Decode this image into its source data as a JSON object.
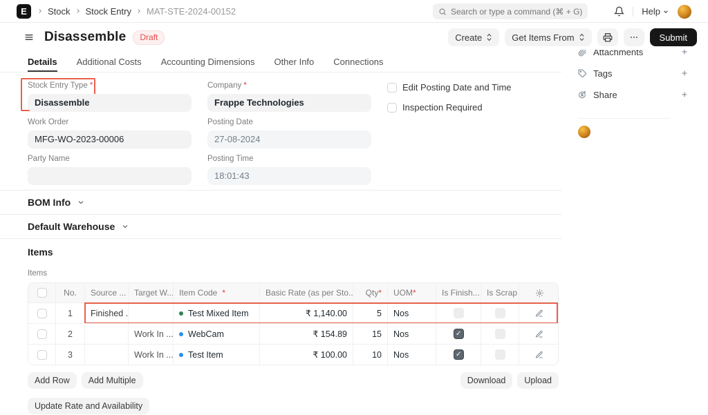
{
  "navbar": {
    "logo_letter": "E",
    "breadcrumb": [
      {
        "label": "Stock"
      },
      {
        "label": "Stock Entry"
      },
      {
        "label": "MAT-STE-2024-00152"
      }
    ],
    "search_placeholder": "Search or type a command (⌘ + G)",
    "help_label": "Help"
  },
  "header": {
    "title": "Disassemble",
    "status_badge": "Draft",
    "create_label": "Create",
    "get_items_from_label": "Get Items From",
    "submit_label": "Submit"
  },
  "tabs": [
    {
      "label": "Details",
      "active": true
    },
    {
      "label": "Additional Costs",
      "active": false
    },
    {
      "label": "Accounting Dimensions",
      "active": false
    },
    {
      "label": "Other Info",
      "active": false
    },
    {
      "label": "Connections",
      "active": false
    }
  ],
  "form": {
    "stock_entry_type": {
      "label": "Stock Entry Type",
      "value": "Disassemble"
    },
    "company": {
      "label": "Company",
      "value": "Frappe Technologies"
    },
    "edit_posting": {
      "label": "Edit Posting Date and Time",
      "checked": false
    },
    "inspection_required": {
      "label": "Inspection Required",
      "checked": false
    },
    "work_order": {
      "label": "Work Order",
      "value": "MFG-WO-2023-00006"
    },
    "posting_date": {
      "label": "Posting Date",
      "value": "27-08-2024"
    },
    "party_name": {
      "label": "Party Name",
      "value": ""
    },
    "posting_time": {
      "label": "Posting Time",
      "value": "18:01:43"
    }
  },
  "sections": {
    "bom_info": "BOM Info",
    "default_warehouse": "Default Warehouse",
    "items_heading": "Items",
    "items_sublabel": "Items"
  },
  "items_table": {
    "columns": [
      {
        "label": "No."
      },
      {
        "label": "Source ..."
      },
      {
        "label": "Target W..."
      },
      {
        "label": "Item Code",
        "required": true
      },
      {
        "label": "Basic Rate (as per Sto..."
      },
      {
        "label": "Qty",
        "required": true
      },
      {
        "label": "UOM",
        "required": true
      },
      {
        "label": "Is Finish..."
      },
      {
        "label": "Is Scrap ..."
      }
    ],
    "rows": [
      {
        "no": "1",
        "source": "Finished ...",
        "target": "",
        "item": "Test Mixed Item",
        "dot_color": "#2e844d",
        "rate": "₹ 1,140.00",
        "qty": "5",
        "uom": "Nos",
        "is_finished": false,
        "is_scrap": false,
        "highlighted": true
      },
      {
        "no": "2",
        "source": "",
        "target": "Work In ...",
        "item": "WebCam",
        "dot_color": "#2490ef",
        "rate": "₹ 154.89",
        "qty": "15",
        "uom": "Nos",
        "is_finished": true,
        "is_scrap": false,
        "highlighted": false
      },
      {
        "no": "3",
        "source": "",
        "target": "Work In ...",
        "item": "Test Item",
        "dot_color": "#2490ef",
        "rate": "₹ 100.00",
        "qty": "10",
        "uom": "Nos",
        "is_finished": true,
        "is_scrap": false,
        "highlighted": false
      }
    ]
  },
  "table_actions": {
    "add_row": "Add Row",
    "add_multiple": "Add Multiple",
    "download": "Download",
    "upload": "Upload",
    "update_rate": "Update Rate and Availability"
  },
  "sidebar": {
    "attachments_label": "Attachments",
    "tags_label": "Tags",
    "share_label": "Share"
  },
  "colors": {
    "annotation_red": "#e8604c",
    "draft_red": "#e24c4c",
    "item_dot_green": "#2e844d",
    "item_dot_blue": "#2490ef"
  }
}
